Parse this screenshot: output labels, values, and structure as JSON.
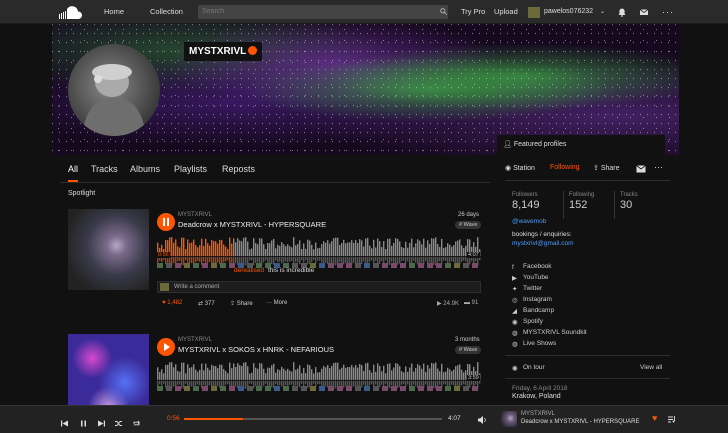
{
  "nav": {
    "home": "Home",
    "collection": "Collection",
    "search_placeholder": "Search",
    "try_pro": "Try Pro",
    "upload": "Upload",
    "username": "pawelos076232"
  },
  "profile": {
    "name": "MYSTXRIVL",
    "featured": "Featured profiles"
  },
  "tabs": [
    "All",
    "Tracks",
    "Albums",
    "Playlists",
    "Reposts"
  ],
  "section": {
    "spotlight": "Spotlight"
  },
  "track1": {
    "artist": "MYSTXRIVL",
    "title": "Deadcrow x MYSTXRIVL - HYPERSQUARE",
    "ago": "26 days",
    "genre": "# Wave",
    "time_current": "0:56",
    "time_total": "4:07",
    "comment_user": "derealised",
    "comment_text": "this is incredible",
    "comment_placeholder": "Write a comment",
    "likes": "1,482",
    "reposts": "377",
    "share": "Share",
    "more": "More",
    "plays": "24.9K",
    "comments": "91",
    "progress_fraction": 0.23
  },
  "track2": {
    "artist": "MYSTXRIVL",
    "title": "MYSTXRIVL x SOKOS x HNRK - NEFARIOUS",
    "ago": "3 months",
    "genre": "# Wave",
    "time_total": "3:59"
  },
  "actions": {
    "station": "Station",
    "following": "Following",
    "share": "Share"
  },
  "stats": {
    "followers_label": "Followers",
    "followers": "8,149",
    "following_label": "Following",
    "following": "152",
    "tracks_label": "Tracks",
    "tracks": "30"
  },
  "bio": {
    "handle": "@wavemob",
    "bookings": "bookings / enquiries:",
    "email": "mystxrivl@gmail.com"
  },
  "social": [
    "Facebook",
    "YouTube",
    "Twitter",
    "Instagram",
    "Bandcamp",
    "Spotify",
    "MYSTXRIVL Soundkit",
    "Live Shows"
  ],
  "tour": {
    "label": "On tour",
    "view_all": "View all",
    "date": "Friday, 6 April 2018",
    "city": "Krakow, Poland"
  },
  "player": {
    "time_current": "0:56",
    "time_total": "4:07",
    "progress_fraction": 0.23,
    "artist": "MYSTXRIVL",
    "title": "Deadcrow x MYSTXRIVL - HYPERSQUARE"
  },
  "colors": {
    "accent": "#ff5500",
    "link": "#4a9cf5",
    "background": "#111111"
  }
}
